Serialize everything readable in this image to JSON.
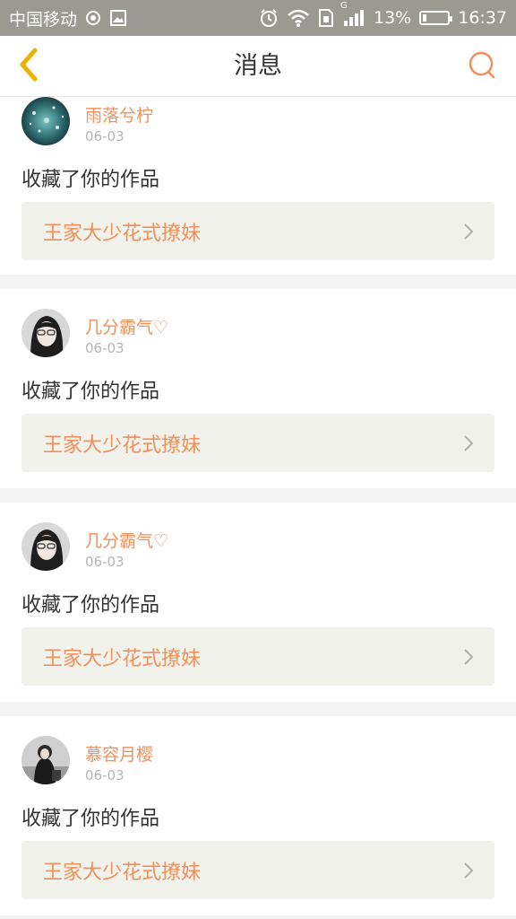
{
  "status_bar": {
    "carrier": "中国移动",
    "battery_percent": "13%",
    "time": "16:37",
    "network": "G",
    "battery_level": 0.13,
    "icons": [
      "eye-icon",
      "image-icon",
      "alarm-icon",
      "wifi-icon",
      "sim-icon",
      "signal-icon",
      "battery-icon"
    ]
  },
  "header": {
    "title": "消息",
    "back_icon": "chevron-left-icon",
    "search_icon": "search-icon"
  },
  "colors": {
    "accent": "#f0905a",
    "back_icon": "#e8b400",
    "status_bar_bg": "#9a9a93",
    "work_bg": "#f2f2ec"
  },
  "messages": [
    {
      "user": "雨落兮柠",
      "date": "06-03",
      "action": "收藏了你的作品",
      "work_title": "王家大少花式撩妹"
    },
    {
      "user": "几分霸气♡",
      "date": "06-03",
      "action": "收藏了你的作品",
      "work_title": "王家大少花式撩妹"
    },
    {
      "user": "几分霸气♡",
      "date": "06-03",
      "action": "收藏了你的作品",
      "work_title": "王家大少花式撩妹"
    },
    {
      "user": "慕容月樱",
      "date": "06-03",
      "action": "收藏了你的作品",
      "work_title": "王家大少花式撩妹"
    }
  ]
}
